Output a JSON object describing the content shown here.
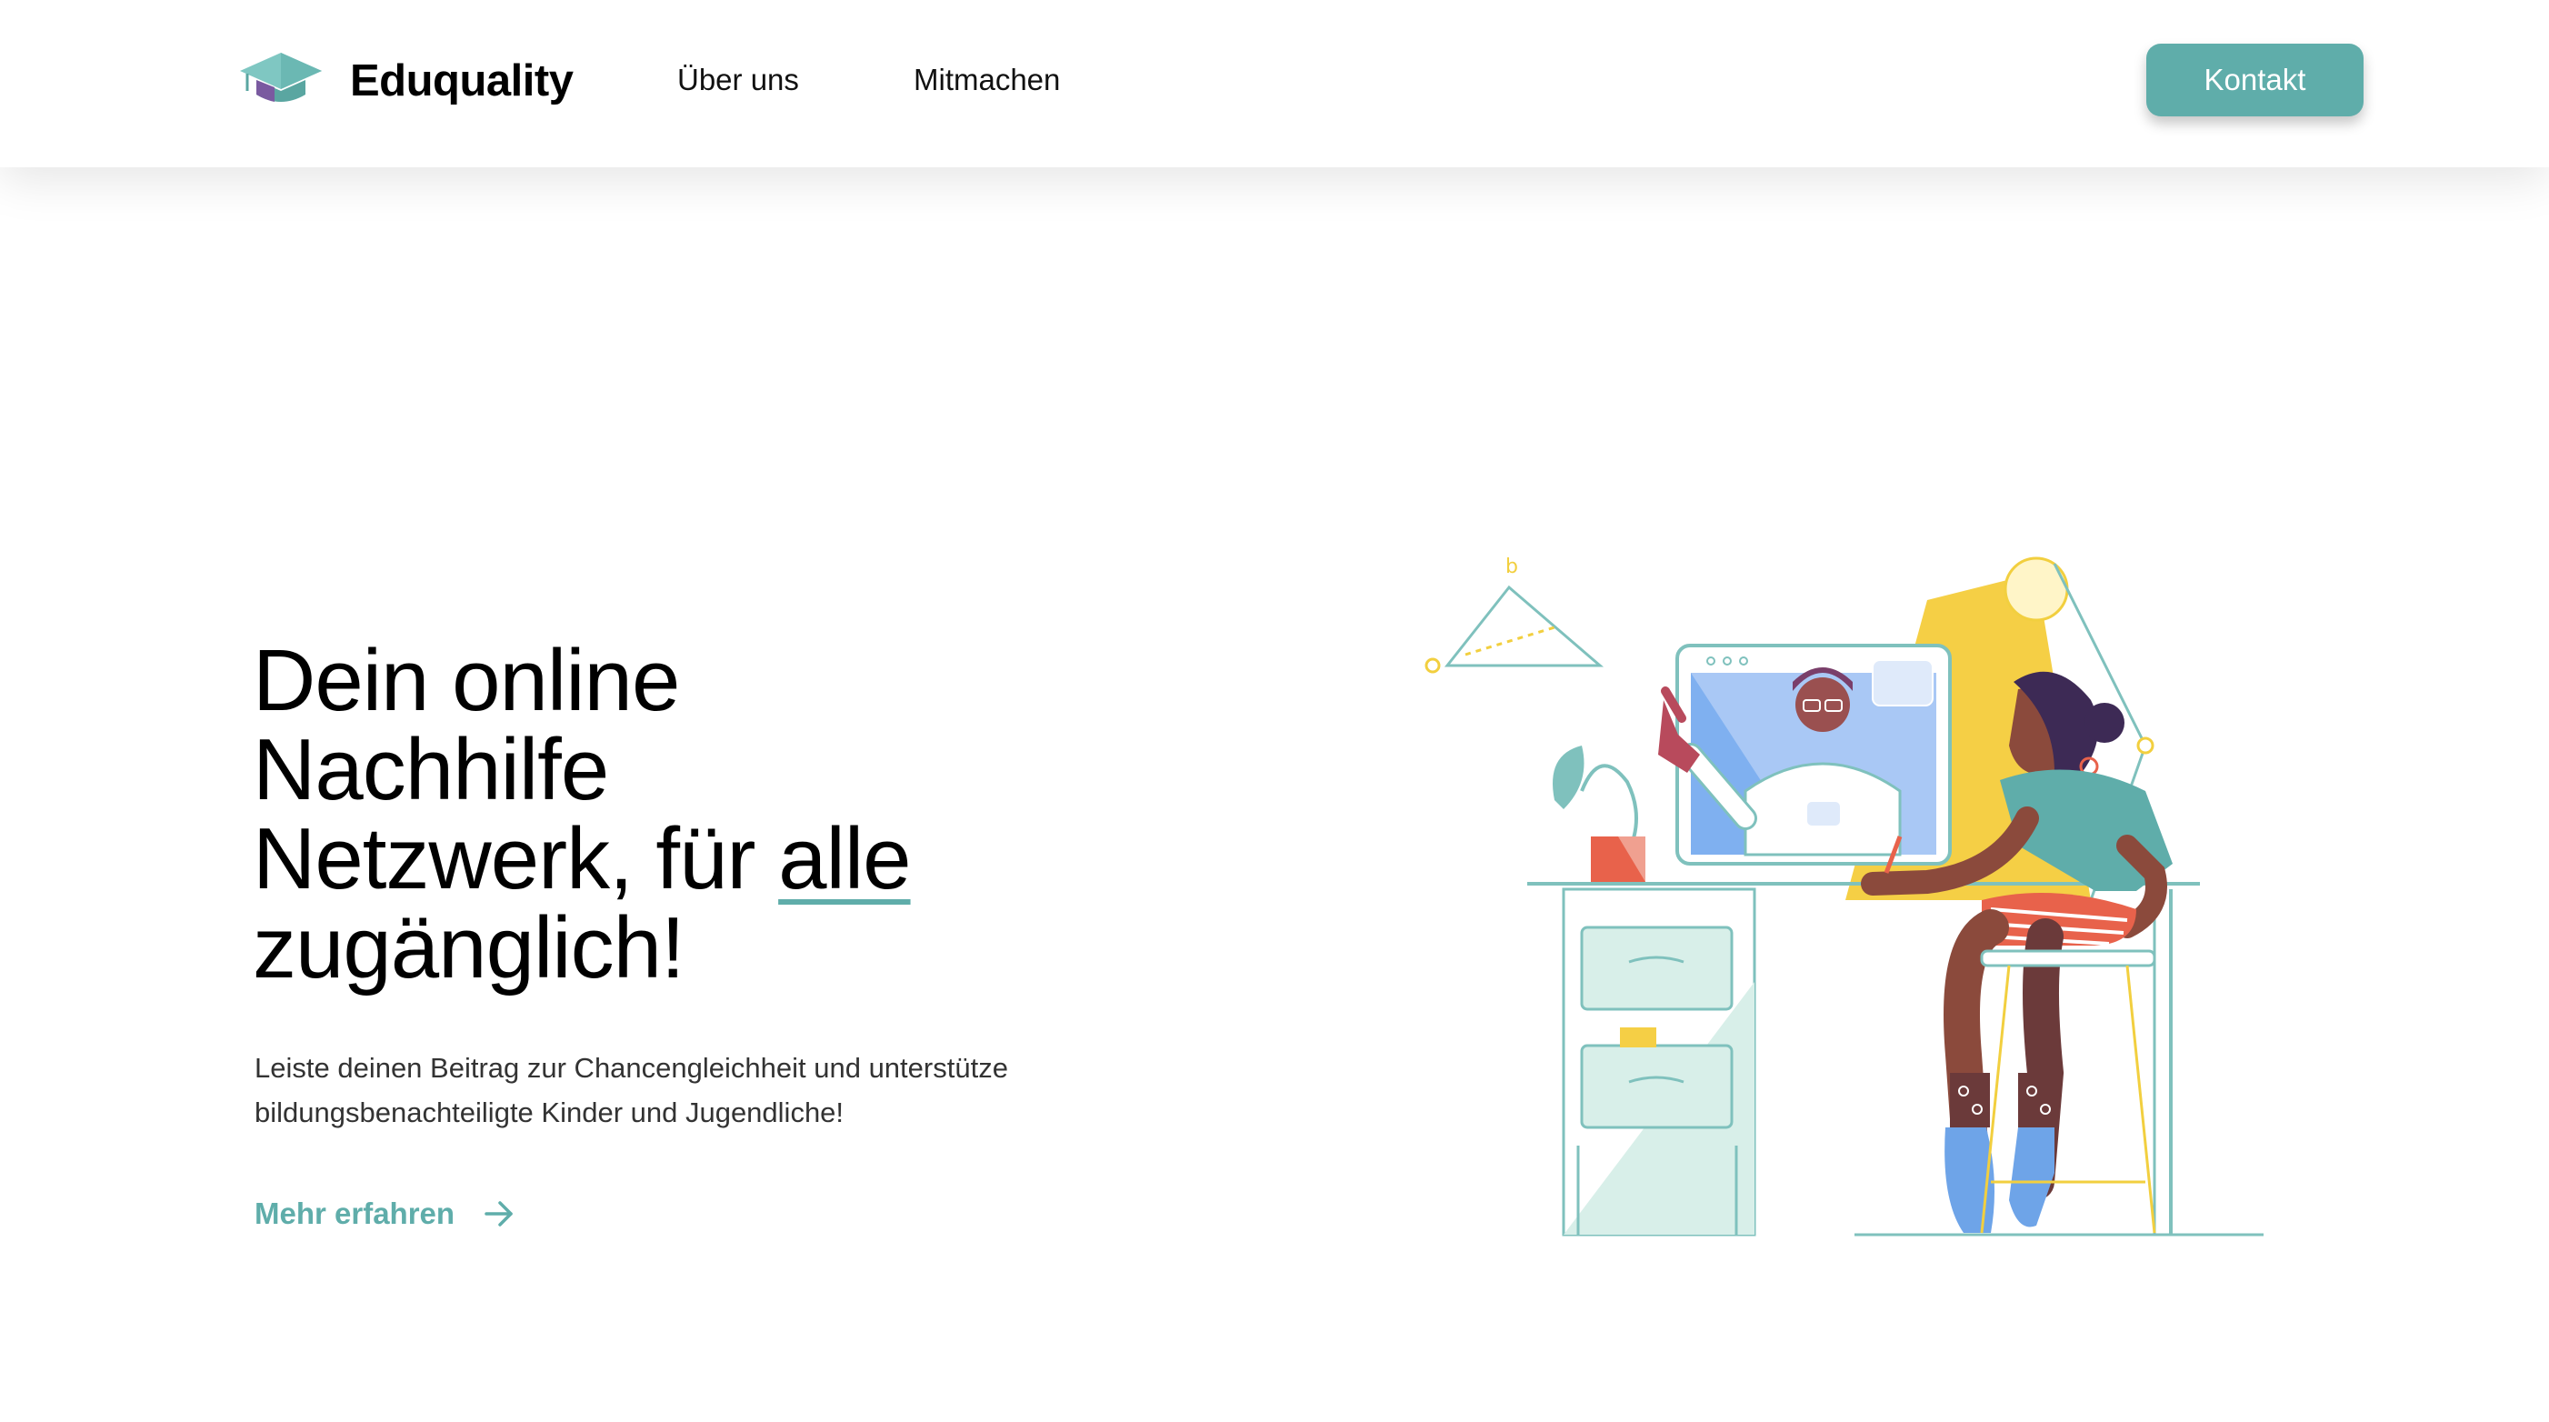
{
  "header": {
    "brand": "Eduquality",
    "nav": [
      {
        "label": "Über uns"
      },
      {
        "label": "Mitmachen"
      }
    ],
    "cta_label": "Kontakt"
  },
  "hero": {
    "title_lines": [
      "Dein online",
      "Nachhilfe"
    ],
    "title_line3_prefix": "Netzwerk, für ",
    "title_highlight": "alle",
    "title_line4": "zugänglich!",
    "subtitle_lines": [
      "Leiste deinen Beitrag zur Chancengleichheit und unterstütze",
      "bildungsbenachteiligte Kinder und Jugendliche!"
    ],
    "more_label": "Mehr erfahren"
  },
  "icons": {
    "logo": "graduation-cap-icon",
    "more": "arrow-right-icon"
  },
  "colors": {
    "accent": "#5fadaa",
    "shadow": "#e8e8e8",
    "text": "#000000"
  }
}
